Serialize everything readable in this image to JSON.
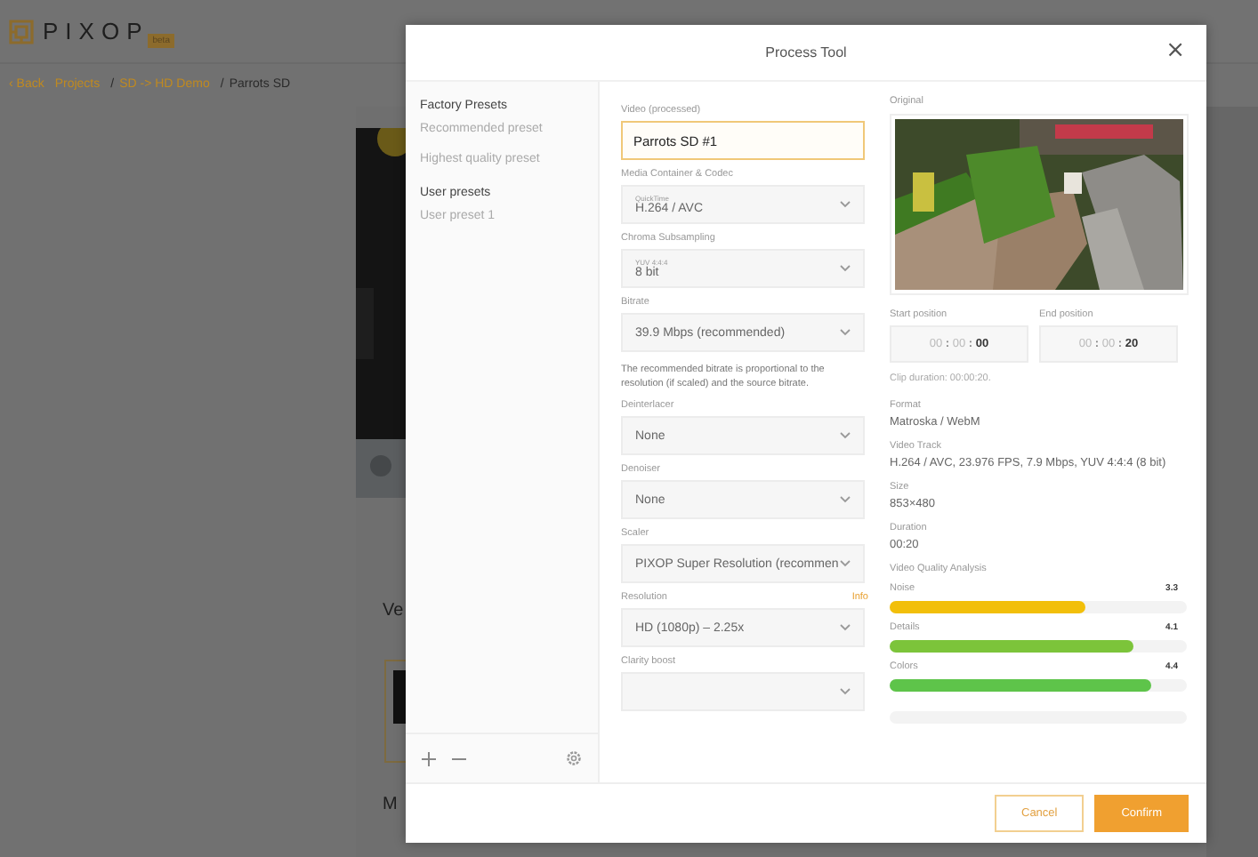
{
  "app": {
    "logo": "PIXOP",
    "badge": "beta"
  },
  "breadcrumb": [
    {
      "text": "‹ Back",
      "kind": "link"
    },
    {
      "text": "Projects",
      "kind": "link"
    },
    {
      "text": "/",
      "kind": "separator"
    },
    {
      "text": "SD -> HD Demo",
      "kind": "link"
    },
    {
      "text": "/",
      "kind": "separator"
    },
    {
      "text": "Parrots SD",
      "kind": "current"
    }
  ],
  "background": {
    "section_title": "Ve",
    "section2_title": "M"
  },
  "modal": {
    "title": "Process Tool",
    "close": "×",
    "preset_groups": [
      {
        "title": "Factory Presets",
        "items": [
          "Recommended preset",
          "Highest quality preset"
        ]
      },
      {
        "title": "User presets",
        "items": [
          "User preset 1"
        ]
      }
    ],
    "settings": [
      {
        "kind": "input",
        "label": "Video (processed)",
        "value": "Parrots SD #1"
      },
      {
        "kind": "select",
        "label": "Media Container & Codec",
        "sublabel": "QuickTime",
        "value": "H.264 / AVC"
      },
      {
        "kind": "select",
        "label": "Chroma Subsampling",
        "sublabel": "YUV 4:4:4",
        "value": "8 bit"
      },
      {
        "kind": "select",
        "label": "Bitrate",
        "value": "39.9 Mbps (recommended)"
      },
      {
        "kind": "note",
        "text": "The recommended bitrate is proportional to the resolution (if scaled) and the source bitrate."
      },
      {
        "kind": "select",
        "label": "Deinterlacer",
        "value": "None"
      },
      {
        "kind": "select",
        "label": "Denoiser",
        "value": "None"
      },
      {
        "kind": "select",
        "label": "Scaler",
        "value": "PIXOP Super Resolution (recommen"
      },
      {
        "kind": "select",
        "label": "Resolution",
        "info": "Info",
        "value": "HD (1080p) – 2.25x"
      },
      {
        "kind": "select",
        "label": "Clarity boost"
      }
    ],
    "original_label": "Original",
    "positions": [
      {
        "label": "Start position",
        "hours": "00",
        "minutes": "00",
        "seconds": "00",
        "separator": ":"
      },
      {
        "label": "End position",
        "hours": "00",
        "minutes": "00",
        "seconds": "20",
        "separator": ":"
      }
    ],
    "clip_duration": "Clip duration: 00:00:20.",
    "info": [
      {
        "label": "Format",
        "value": "Matroska / WebM"
      },
      {
        "label": "Video Track",
        "value": "H.264 / AVC, 23.976 FPS, 7.9 Mbps, YUV 4:4:4 (8 bit)"
      },
      {
        "label": "Size",
        "value": "853×480"
      },
      {
        "label": "Duration",
        "value": "00:20"
      }
    ],
    "analysis_title": "Video Quality Analysis",
    "metrics": [
      {
        "name": "Noise",
        "score": "3.3",
        "level": 0.66,
        "color": "#f2bf0a"
      },
      {
        "name": "Details",
        "score": "4.1",
        "level": 0.82,
        "color": "#7cc43a"
      },
      {
        "name": "Colors",
        "score": "4.4",
        "level": 0.88,
        "color": "#5ec44a"
      }
    ],
    "buttons": [
      {
        "label": "Cancel",
        "kind": "secondary"
      },
      {
        "label": "Confirm",
        "kind": "primary"
      }
    ]
  }
}
